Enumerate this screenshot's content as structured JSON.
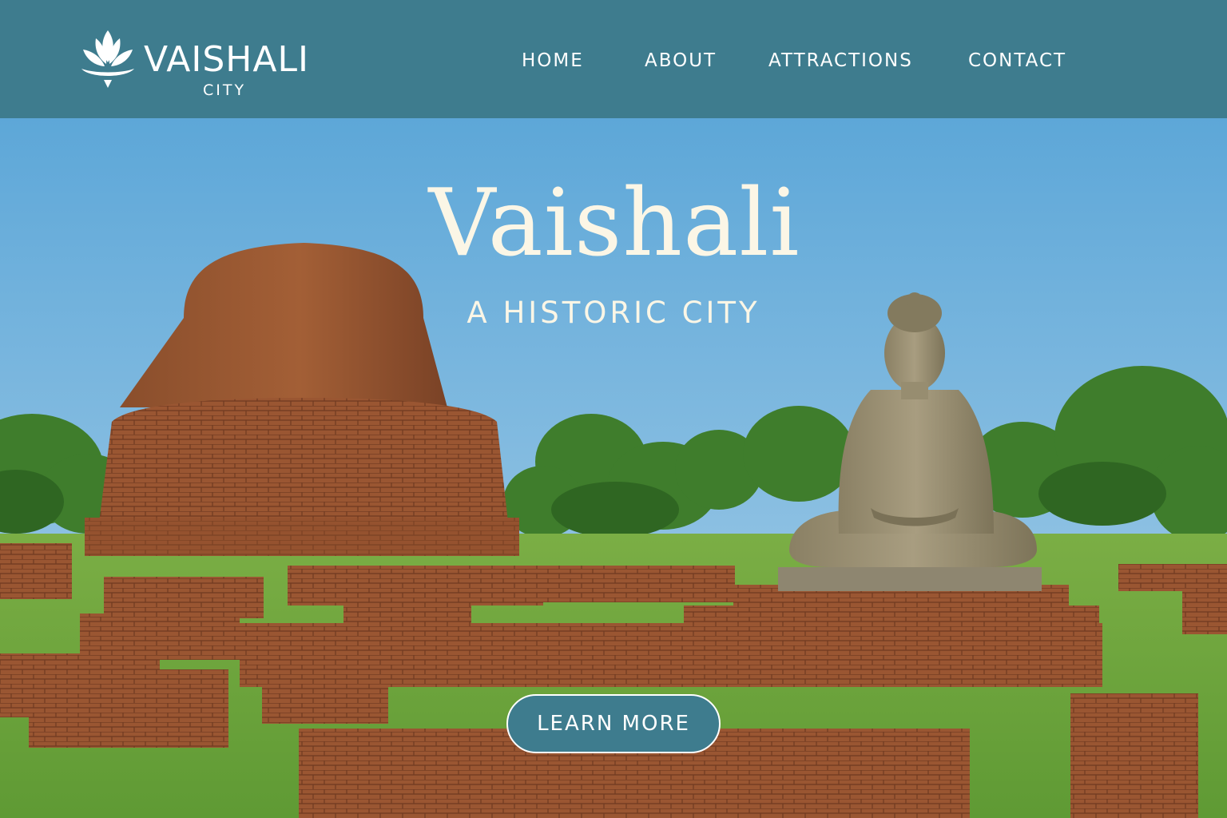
{
  "header": {
    "logo": {
      "title": "VAISHALI",
      "subtitle": "CITY",
      "icon": "lotus-icon"
    },
    "nav": [
      {
        "label": "HOME"
      },
      {
        "label": "ABOUT"
      },
      {
        "label": "ATTRACTIONS"
      },
      {
        "label": "CONTACT"
      }
    ]
  },
  "hero": {
    "title": "Vaishali",
    "subtitle": "A HISTORIC CITY",
    "cta_label": "LEARN MORE"
  },
  "colors": {
    "header_bg": "#3e7c8e",
    "button_bg": "#3e7c8e",
    "hero_text": "#fbf6e6",
    "sky": "#6aaede",
    "brick": "#9a5a34",
    "grass": "#6fa63b"
  }
}
